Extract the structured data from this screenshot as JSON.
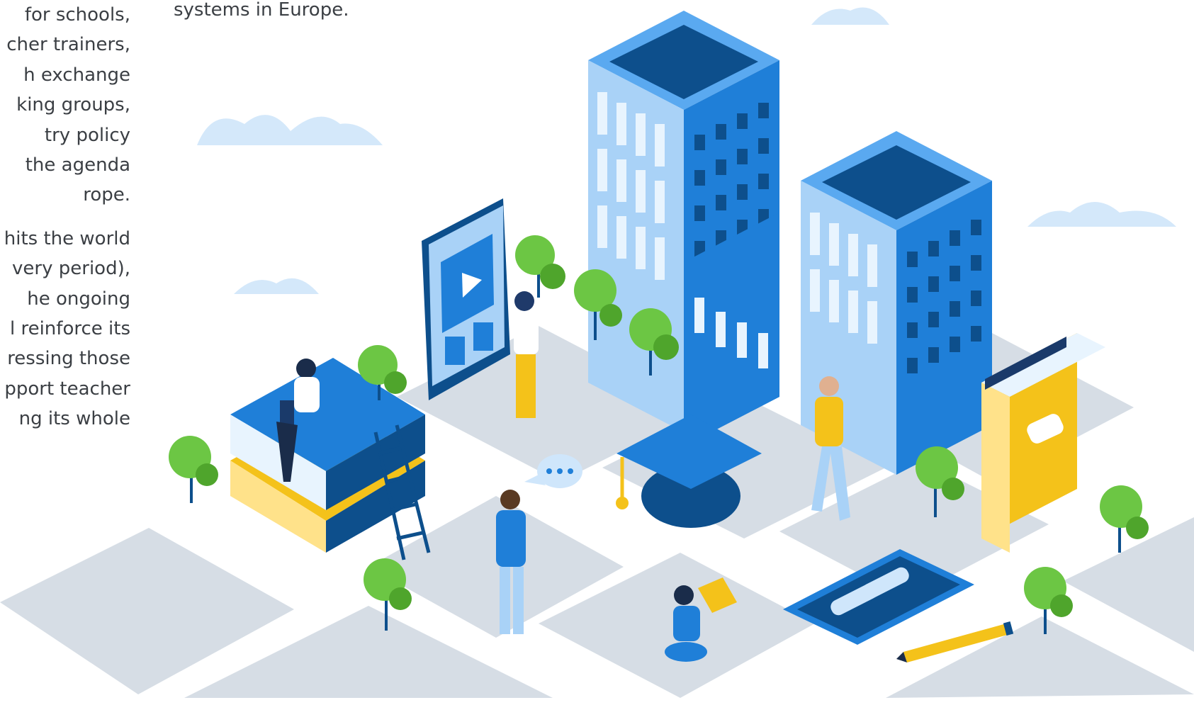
{
  "left_column": {
    "paragraph_1": [
      "for schools,",
      "cher trainers,",
      "h exchange",
      "king groups,",
      "try policy",
      "the agenda",
      "rope."
    ],
    "paragraph_2": [
      "hits the world",
      "very period),",
      "he ongoing",
      "l reinforce its",
      "ressing those",
      "pport teacher",
      "ng its whole"
    ]
  },
  "top_text": {
    "line": "systems in Europe."
  },
  "illustration": {
    "colors": {
      "building_blue": "#1f7fd8",
      "building_dark": "#0d4f8c",
      "window_light": "#cfe6fb",
      "tree_green": "#6cc644",
      "book_yellow": "#f4c21a",
      "tile_gray": "#d6dde5",
      "cloud": "#d4e8fa"
    },
    "icons": [
      "building-icon",
      "tablet-icon",
      "play-icon",
      "graduation-cap-icon",
      "book-icon",
      "pencil-icon",
      "speech-bubble-icon",
      "ladder-icon",
      "tree-icon"
    ]
  }
}
